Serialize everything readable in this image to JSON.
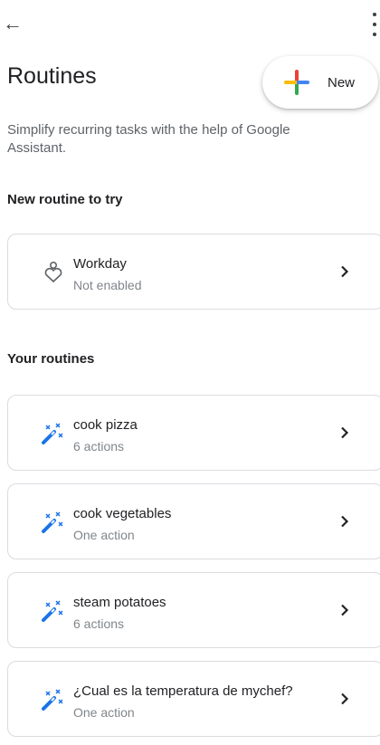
{
  "header": {
    "back_icon": "arrow-left-icon",
    "menu_icon": "more-vert-icon"
  },
  "page": {
    "title": "Routines",
    "new_button_label": "New",
    "subtitle": "Simplify recurring tasks with the help of Google Assistant."
  },
  "suggested": {
    "heading": "New routine to try",
    "items": [
      {
        "title": "Workday",
        "subtitle": "Not enabled",
        "icon": "workday-person-icon"
      }
    ]
  },
  "your_routines": {
    "heading": "Your routines",
    "items": [
      {
        "title": "cook pizza",
        "subtitle": "6 actions",
        "icon": "magic-wand-icon"
      },
      {
        "title": "cook vegetables",
        "subtitle": "One action",
        "icon": "magic-wand-icon"
      },
      {
        "title": "steam potatoes",
        "subtitle": "6 actions",
        "icon": "magic-wand-icon"
      },
      {
        "title": "¿Cual es la temperatura de mychef?",
        "subtitle": "One action",
        "icon": "magic-wand-icon"
      }
    ]
  },
  "colors": {
    "wand_blue": "#1a73e8",
    "google_red": "#ea4335",
    "google_yellow": "#fbbc05",
    "google_green": "#34a853",
    "google_blue": "#4285f4",
    "secondary_text": "#5f6368",
    "card_border": "#dadce0"
  }
}
